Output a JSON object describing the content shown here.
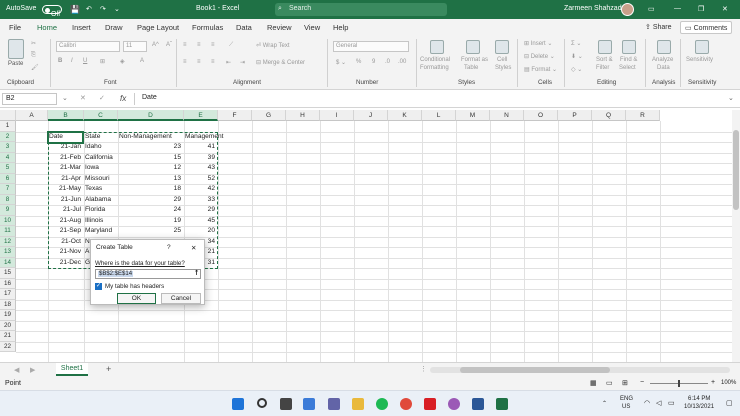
{
  "titlebar": {
    "autosave": "AutoSave",
    "toggle": "Off",
    "filename": "Book1 - Excel",
    "search": "Search",
    "user": "Zarmeen Shahzad"
  },
  "tabs": [
    "File",
    "Home",
    "Insert",
    "Draw",
    "Page Layout",
    "Formulas",
    "Data",
    "Review",
    "View",
    "Help"
  ],
  "share": "Share",
  "comments": "Comments",
  "ribbon": {
    "font_name": "Calibri",
    "font_size": "11",
    "wrap": "Wrap Text",
    "merge": "Merge & Center",
    "number_format": "General",
    "cond": "Conditional",
    "cond2": "Formatting",
    "fmt_table": "Format as",
    "fmt_table2": "Table",
    "cell_styles": "Cell",
    "cell_styles2": "Styles",
    "insert": "Insert",
    "delete": "Delete",
    "format": "Format",
    "sort": "Sort &",
    "sort2": "Filter",
    "find": "Find &",
    "find2": "Select",
    "analyze": "Analyze",
    "analyze2": "Data",
    "sensitivity": "Sensitivity",
    "paste": "Paste",
    "groups": [
      "Clipboard",
      "Font",
      "Alignment",
      "Number",
      "Styles",
      "Cells",
      "Editing",
      "Analysis",
      "Sensitivity"
    ]
  },
  "formula": {
    "namebox": "B2",
    "fx": "fx",
    "value": "Date"
  },
  "columns": [
    "A",
    "B",
    "C",
    "D",
    "E",
    "F",
    "G",
    "H",
    "I",
    "J",
    "K",
    "L",
    "M",
    "N",
    "O",
    "P",
    "Q",
    "R"
  ],
  "rows": [
    "1",
    "2",
    "3",
    "4",
    "5",
    "6",
    "7",
    "8",
    "9",
    "10",
    "11",
    "12",
    "13",
    "14",
    "15",
    "16",
    "17",
    "18",
    "19",
    "20",
    "21",
    "22"
  ],
  "headers": {
    "date": "Date",
    "state": "State",
    "nonmgmt": "Non-Management",
    "mgmt": "Management"
  },
  "data": [
    {
      "date": "21-Jan",
      "state": "Idaho",
      "non": "23",
      "mgmt": "41"
    },
    {
      "date": "21-Feb",
      "state": "California",
      "non": "15",
      "mgmt": "39"
    },
    {
      "date": "21-Mar",
      "state": "Iowa",
      "non": "12",
      "mgmt": "43"
    },
    {
      "date": "21-Apr",
      "state": "Missouri",
      "non": "13",
      "mgmt": "52"
    },
    {
      "date": "21-May",
      "state": "Texas",
      "non": "18",
      "mgmt": "42"
    },
    {
      "date": "21-Jun",
      "state": "Alabama",
      "non": "29",
      "mgmt": "33"
    },
    {
      "date": "21-Jul",
      "state": "Florida",
      "non": "24",
      "mgmt": "29"
    },
    {
      "date": "21-Aug",
      "state": "Illinois",
      "non": "19",
      "mgmt": "45"
    },
    {
      "date": "21-Sep",
      "state": "Maryland",
      "non": "25",
      "mgmt": "20"
    },
    {
      "date": "21-Oct",
      "state": "N",
      "non": "",
      "mgmt": "34"
    },
    {
      "date": "21-Nov",
      "state": "A",
      "non": "",
      "mgmt": "21"
    },
    {
      "date": "21-Dec",
      "state": "G",
      "non": "",
      "mgmt": "31"
    }
  ],
  "dialog": {
    "title": "Create Table",
    "help": "?",
    "close": "✕",
    "prompt": "Where is the data for your table?",
    "range": "$B$2:$E$14",
    "headers_label": "My table has headers",
    "ok": "OK",
    "cancel": "Cancel"
  },
  "sheet": {
    "name": "Sheet1",
    "add": "+"
  },
  "status": {
    "mode": "Point",
    "zoom": "100%"
  },
  "taskbar": {
    "lang1": "ENG",
    "lang2": "US",
    "time": "6:14 PM",
    "date": "10/13/2021"
  },
  "colors": {
    "accent": "#1f7145",
    "dialog_blue": "#1a6fc4"
  }
}
